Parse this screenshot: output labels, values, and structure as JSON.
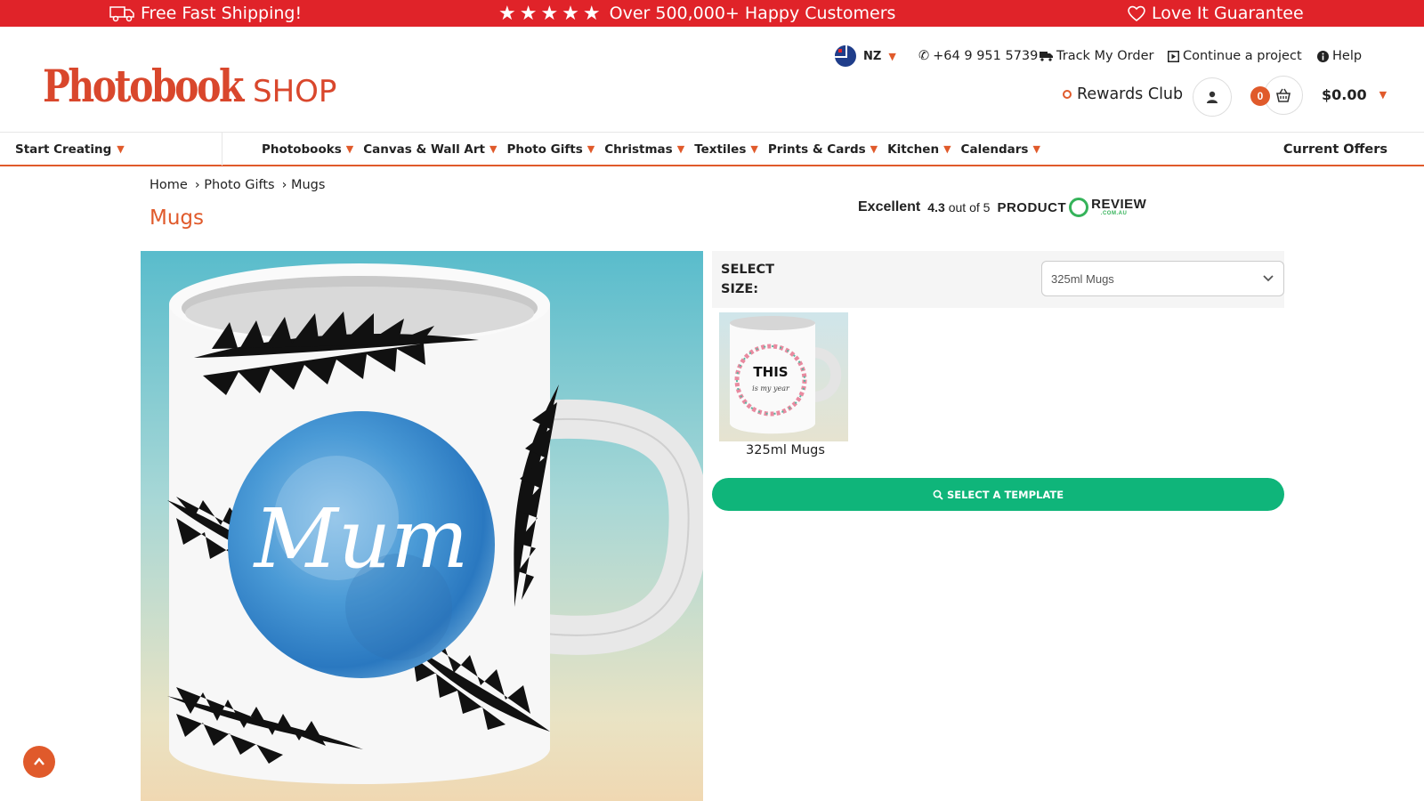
{
  "promo": {
    "shipping": "Free Fast Shipping!",
    "customers": "Over 500,000+ Happy Customers",
    "guarantee": "Love It Guarantee"
  },
  "logo": {
    "main": "Photobook",
    "sub": "SHOP"
  },
  "util": {
    "country": "NZ",
    "phone": "+64 9 951 5739",
    "track": "Track My Order",
    "continue": "Continue a project",
    "help": "Help"
  },
  "account": {
    "rewards": "Rewards Club",
    "cart_count": "0",
    "cart_total": "$0.00"
  },
  "nav": {
    "start": "Start Creating",
    "items": [
      {
        "label": "Photobooks"
      },
      {
        "label": "Canvas & Wall Art"
      },
      {
        "label": "Photo Gifts"
      },
      {
        "label": "Christmas"
      },
      {
        "label": "Textiles"
      },
      {
        "label": "Prints & Cards"
      },
      {
        "label": "Kitchen"
      },
      {
        "label": "Calendars"
      }
    ],
    "offers": "Current Offers"
  },
  "breadcrumb": [
    "Home",
    "› Photo Gifts",
    "› Mugs"
  ],
  "page_title": "Mugs",
  "review": {
    "rating_text": "Excellent",
    "score": "4.3",
    "out_of": "out of 5",
    "brand_a": "PRODUCT",
    "brand_b": "REVIEW",
    "brand_small": ".COM.AU"
  },
  "product_image": {
    "text": "Mum"
  },
  "size": {
    "label": "SELECT SIZE:",
    "selected": "325ml Mugs"
  },
  "thumbnail": {
    "label": "325ml Mugs",
    "text_big": "THIS",
    "text_small": "is my year"
  },
  "cta": "SELECT A TEMPLATE",
  "colors": {
    "promo_red": "#e02329",
    "accent_orange": "#e05a2b",
    "cta_green": "#0fb57a"
  }
}
